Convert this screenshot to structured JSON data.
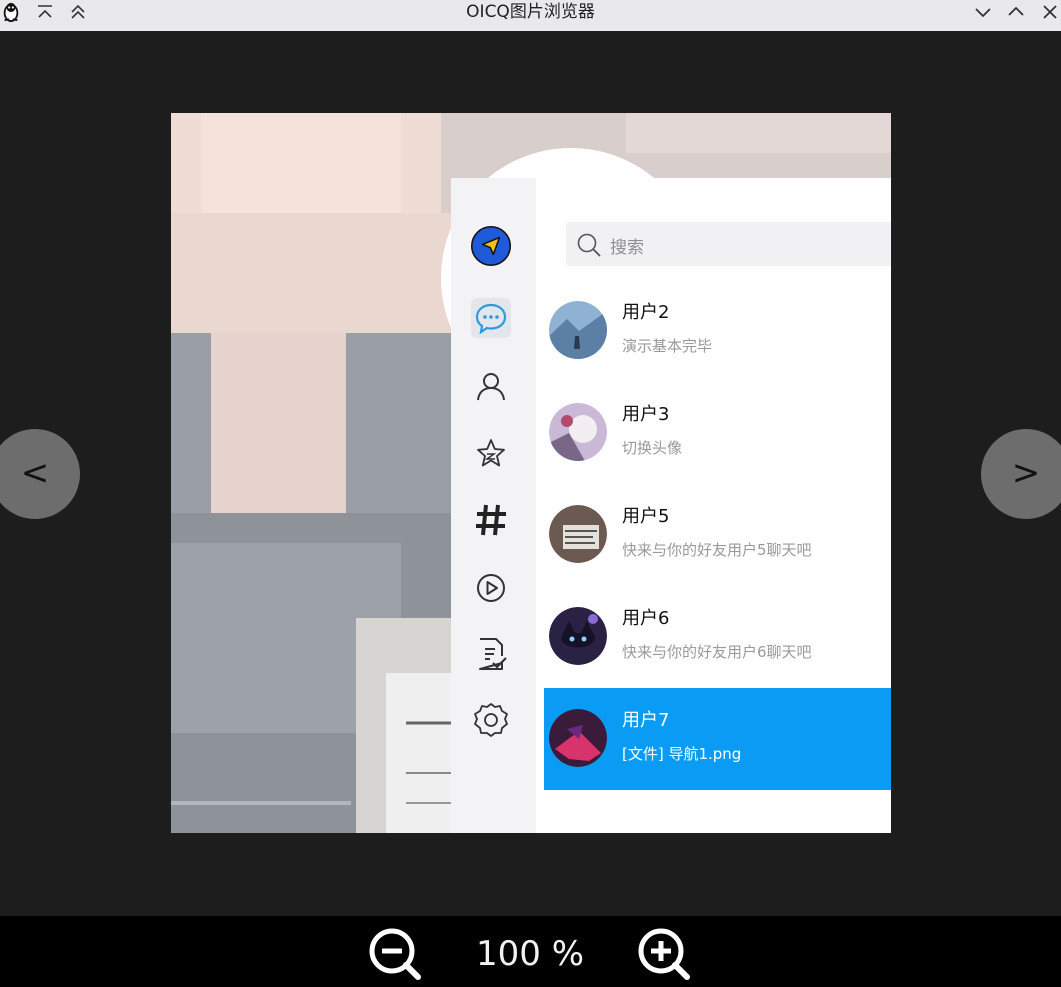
{
  "window": {
    "title": "OICQ图片浏览器",
    "logo_icon": "penguin-icon",
    "left_controls": [
      "collapse-up-icon",
      "double-chevron-up-icon"
    ],
    "right_controls": [
      "minimize-chevron-down-icon",
      "maximize-chevron-up-icon",
      "close-icon"
    ]
  },
  "viewer": {
    "prev_label": "<",
    "next_label": ">",
    "zoom_out_icon": "zoom-out-icon",
    "zoom_in_icon": "zoom-in-icon",
    "zoom_level": "100 %"
  },
  "image_content": {
    "sidebar_icons": [
      "send-icon",
      "chat-icon",
      "contacts-icon",
      "star-icon",
      "hashtag-icon",
      "play-icon",
      "document-icon",
      "settings-icon"
    ],
    "search_placeholder": "搜索",
    "conversations": [
      {
        "name": "用户2",
        "message": "演示基本完毕",
        "selected": false
      },
      {
        "name": "用户3",
        "message": "切换头像",
        "selected": false
      },
      {
        "name": "用户5",
        "message": "快来与你的好友用户5聊天吧",
        "selected": false
      },
      {
        "name": "用户6",
        "message": "快来与你的好友用户6聊天吧",
        "selected": false
      },
      {
        "name": "用户7",
        "message": "[文件] 导航1.png",
        "selected": true
      }
    ],
    "colors": {
      "accent": "#0a9cf5",
      "send_badge": "#1f5bd8",
      "send_badge_fill": "#f3c017"
    }
  }
}
